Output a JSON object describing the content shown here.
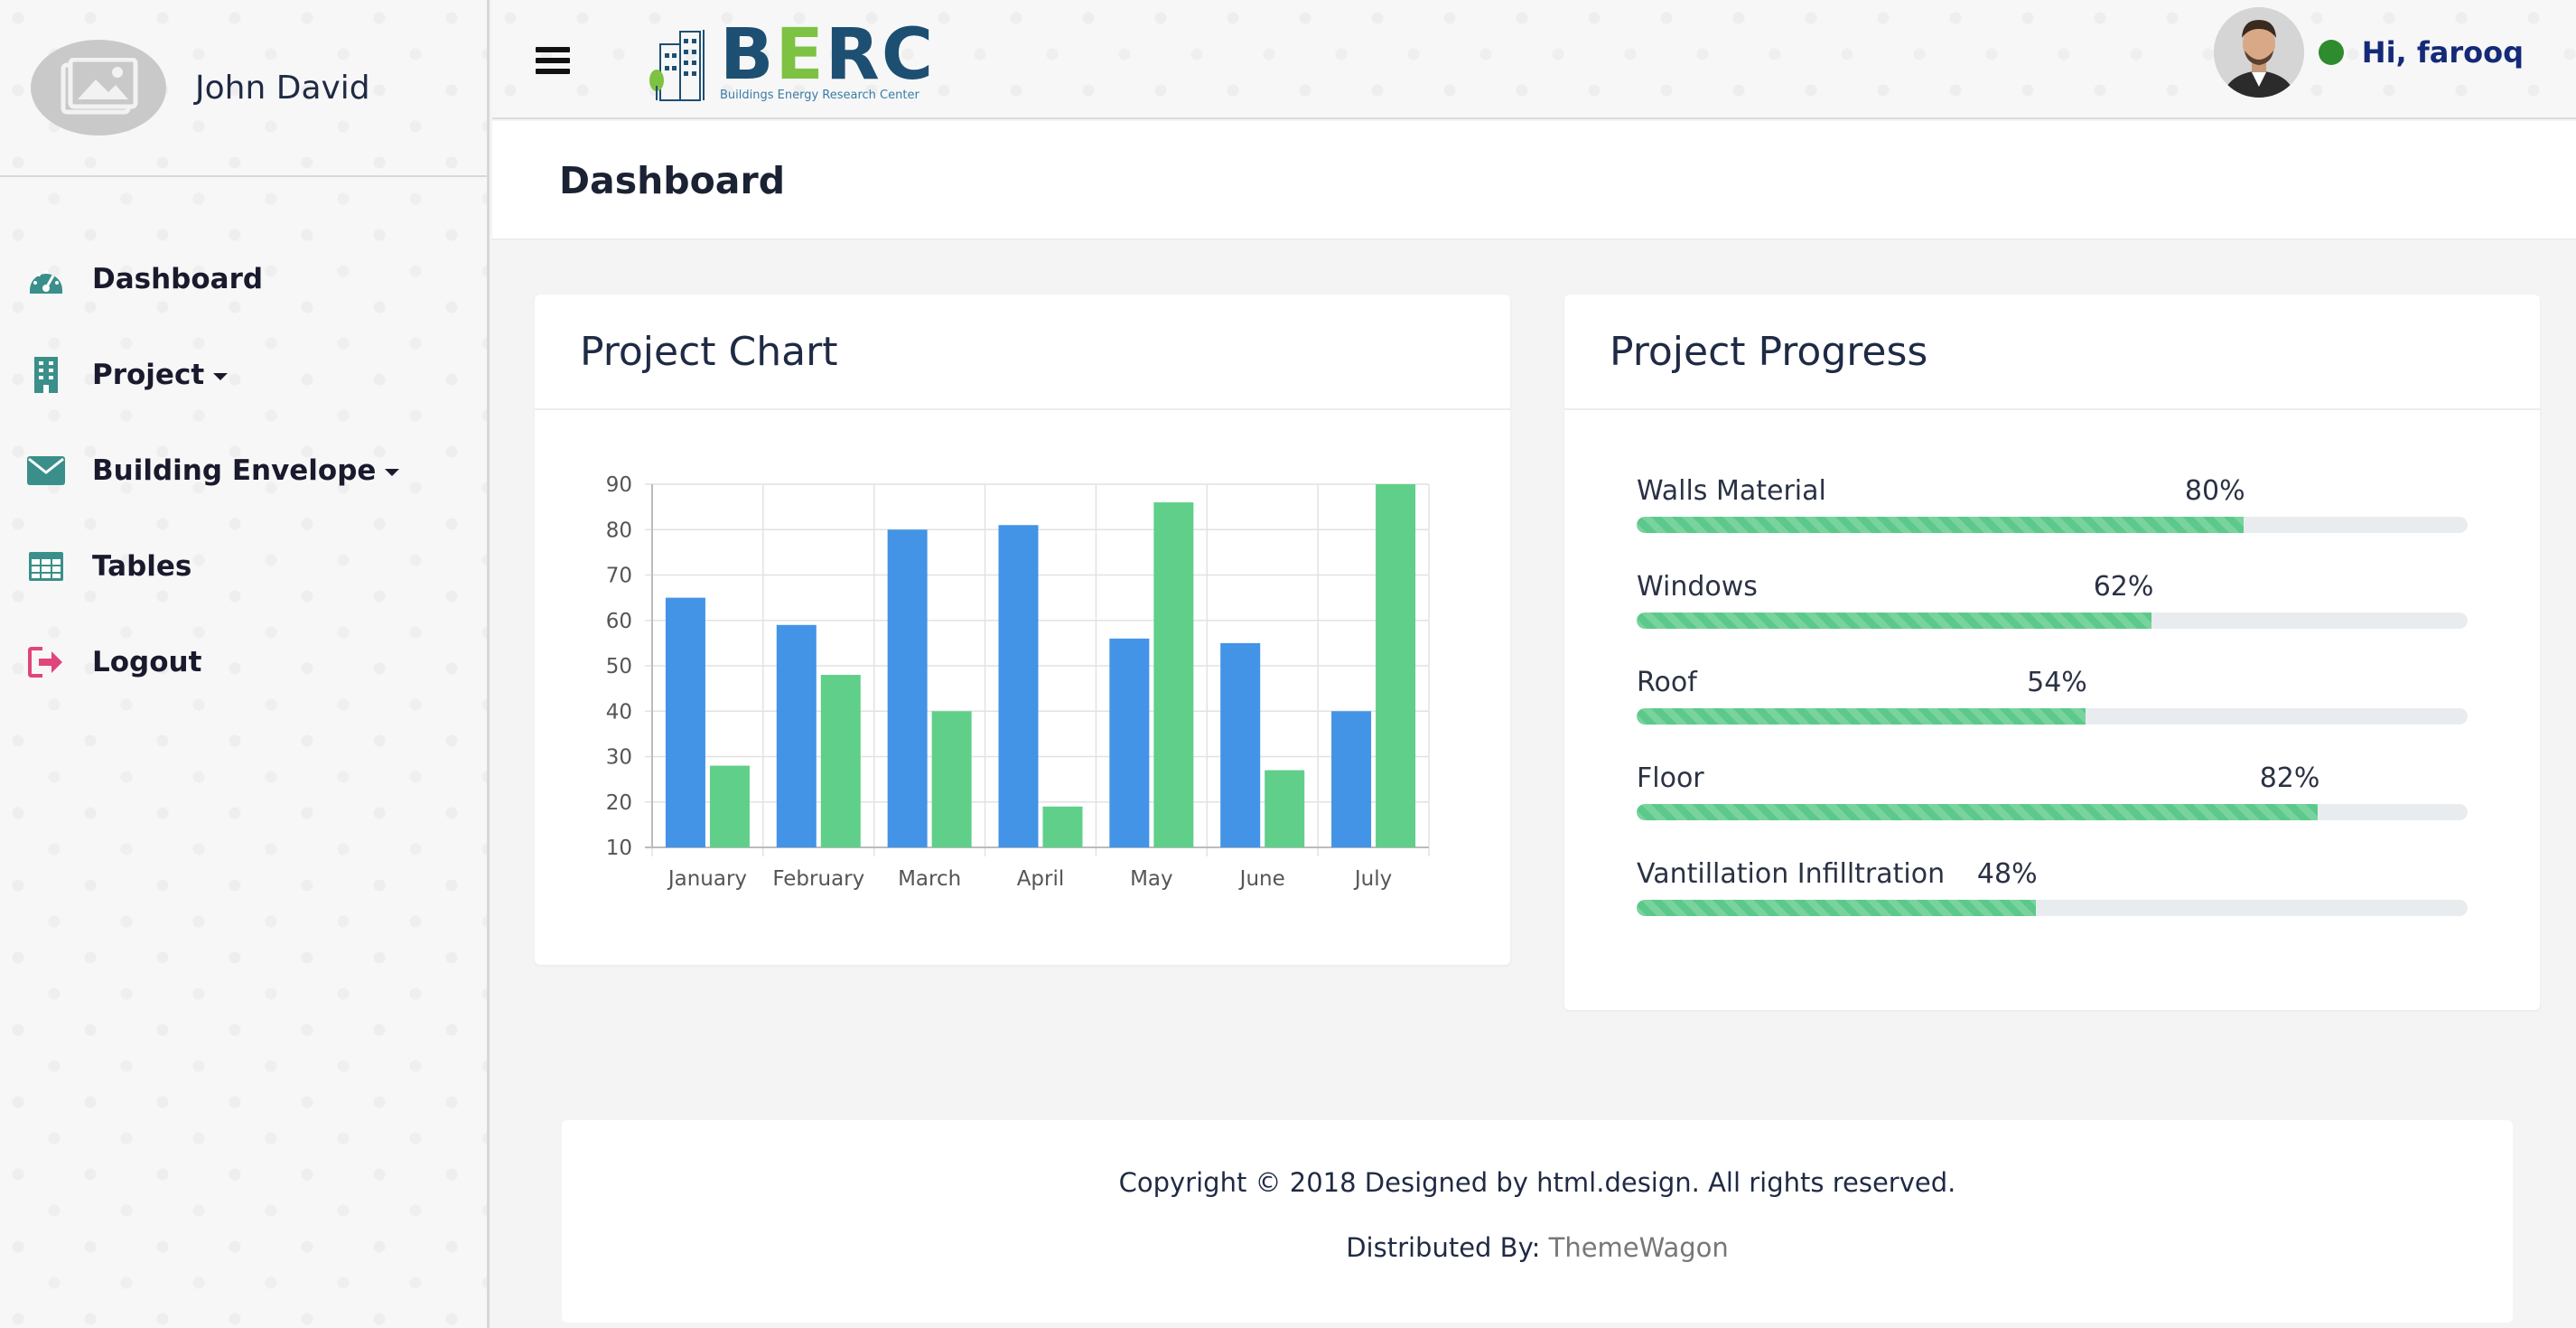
{
  "sidebar": {
    "profile_name": "John David",
    "items": [
      {
        "label": "Dashboard",
        "icon": "dashboard-gauge-icon",
        "has_caret": false
      },
      {
        "label": "Project",
        "icon": "building-icon",
        "has_caret": true
      },
      {
        "label": "Building Envelope",
        "icon": "envelope-icon",
        "has_caret": true
      },
      {
        "label": "Tables",
        "icon": "table-icon",
        "has_caret": false
      },
      {
        "label": "Logout",
        "icon": "logout-icon",
        "has_caret": false
      }
    ]
  },
  "topbar": {
    "logo_word": "BERC",
    "logo_sub": "Buildings Energy Research Center",
    "greeting": "Hi, farooq",
    "status_color": "#2e8b2e"
  },
  "page": {
    "title": "Dashboard"
  },
  "chart_card": {
    "title": "Project Chart"
  },
  "chart_data": {
    "type": "bar",
    "categories": [
      "January",
      "February",
      "March",
      "April",
      "May",
      "June",
      "July"
    ],
    "series": [
      {
        "values": [
          65,
          59,
          80,
          81,
          56,
          55,
          40
        ],
        "color": "#4393e6"
      },
      {
        "values": [
          28,
          48,
          40,
          19,
          86,
          27,
          90
        ],
        "color": "#5fcf8a"
      }
    ],
    "ylim": [
      10,
      90
    ],
    "yticks": [
      10,
      20,
      30,
      40,
      50,
      60,
      70,
      80,
      90
    ],
    "grid": true,
    "title": "",
    "xlabel": "",
    "ylabel": ""
  },
  "progress_card": {
    "title": "Project Progress",
    "items": [
      {
        "label": "Walls Material",
        "percent_text": "80%",
        "value": 0.73
      },
      {
        "label": "Windows",
        "percent_text": "62%",
        "value": 0.62
      },
      {
        "label": "Roof",
        "percent_text": "54%",
        "value": 0.54
      },
      {
        "label": "Floor",
        "percent_text": "82%",
        "value": 0.82
      },
      {
        "label": "Vantillation Infilltration",
        "percent_text": "48%",
        "value": 0.48
      }
    ],
    "bar_color": "#5cc98a"
  },
  "footer": {
    "copyright": "Copyright © 2018 Designed by html.design. All rights reserved.",
    "distributed_prefix": "Distributed By: ",
    "distributed_link": "ThemeWagon"
  }
}
